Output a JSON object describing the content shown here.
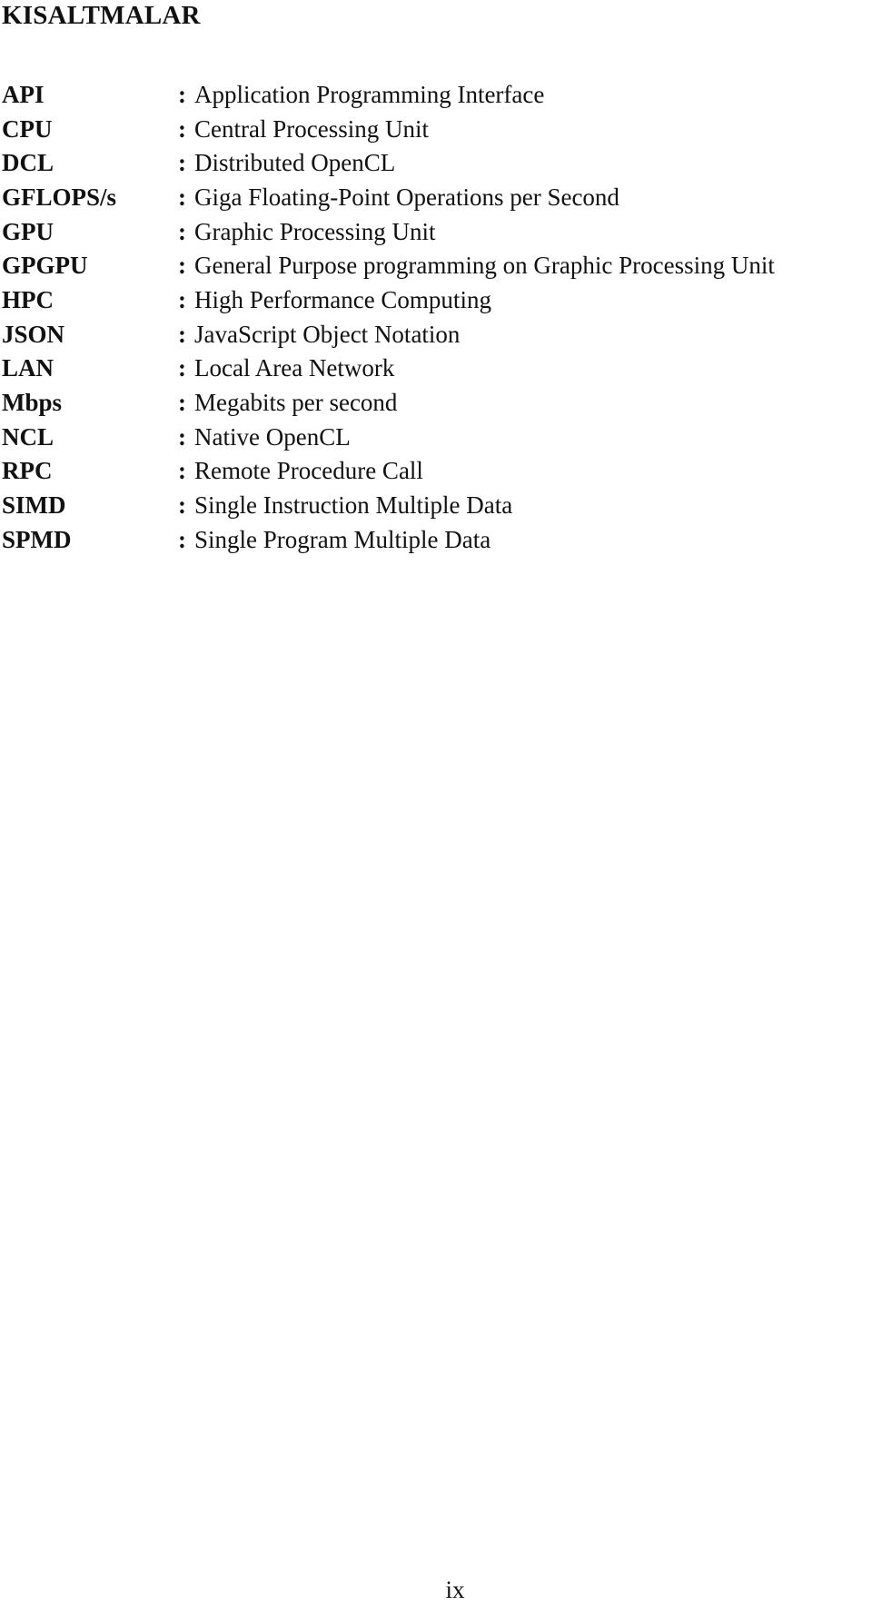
{
  "title": "KISALTMALAR",
  "separator": ":",
  "abbreviations": [
    {
      "term": "API",
      "definition": "Application Programming Interface"
    },
    {
      "term": "CPU",
      "definition": "Central Processing Unit"
    },
    {
      "term": "DCL",
      "definition": "Distributed OpenCL"
    },
    {
      "term": "GFLOPS/s",
      "definition": "Giga Floating-Point Operations per Second"
    },
    {
      "term": "GPU",
      "definition": "Graphic Processing Unit"
    },
    {
      "term": "GPGPU",
      "definition": "General Purpose programming on Graphic Processing Unit"
    },
    {
      "term": "HPC",
      "definition": "High Performance Computing"
    },
    {
      "term": "JSON",
      "definition": "JavaScript Object Notation"
    },
    {
      "term": "LAN",
      "definition": "Local Area Network"
    },
    {
      "term": "Mbps",
      "definition": "Megabits per second"
    },
    {
      "term": "NCL",
      "definition": "Native OpenCL"
    },
    {
      "term": "RPC",
      "definition": "Remote Procedure Call"
    },
    {
      "term": "SIMD",
      "definition": "Single Instruction Multiple Data"
    },
    {
      "term": "SPMD",
      "definition": "Single Program Multiple Data"
    }
  ],
  "page_number": "ix"
}
